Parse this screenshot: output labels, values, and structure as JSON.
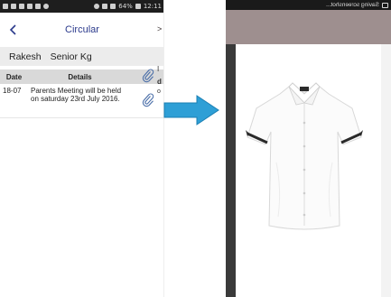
{
  "left_screen": {
    "status_bar": {
      "battery": "64%",
      "time": "12:11"
    },
    "header": {
      "back_icon": "chevron-left-icon",
      "title": "Circular"
    },
    "student": {
      "name": "Rakesh",
      "class": "Senior Kg"
    },
    "table": {
      "headers": {
        "date": "Date",
        "details": "Details",
        "attachment_icon": "paperclip-icon"
      },
      "rows": [
        {
          "date": "18-07",
          "details": "Parents Meeting will be held on saturday 23rd July 2016.",
          "attachment_icon": "paperclip-icon"
        }
      ]
    }
  },
  "arrow": {
    "icon": "right-arrow-icon",
    "color": "#2e9fd6"
  },
  "right_screen": {
    "status_bar": {
      "text": "Saving screenshot..."
    },
    "edge_text": {
      "top": ">",
      "line1": "I",
      "line2": "d",
      "line3": "o"
    },
    "viewer": {
      "image": "white school shirt with black trim"
    }
  },
  "colors": {
    "accent": "#2b3a8c",
    "student_bar": "#ececec",
    "table_header": "#d9d9d9",
    "arrow": "#2e9fd6"
  }
}
